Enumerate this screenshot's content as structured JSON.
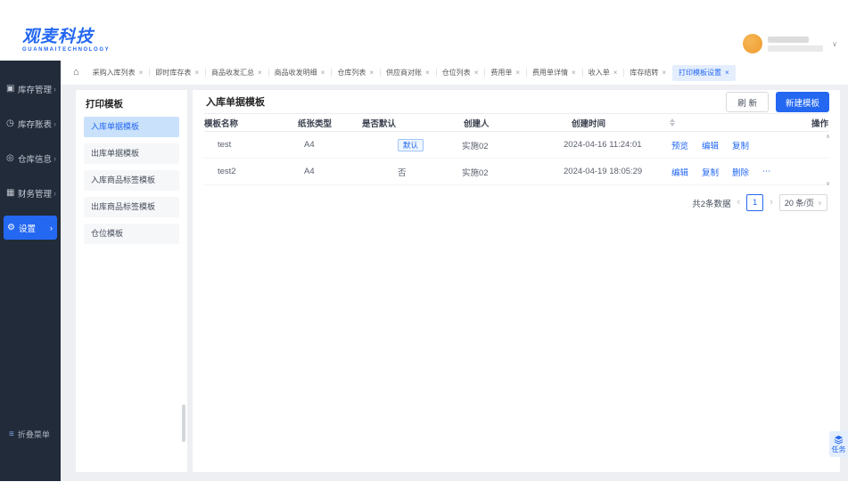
{
  "colors": {
    "primary": "#2468f2",
    "sidebar_bg": "#222b3a",
    "content_bg": "#edeff2",
    "avatar": "#f0a53e"
  },
  "header": {
    "logo_title": "观麦科技",
    "logo_subtitle": "GUANMAITECHNOLOGY",
    "user_menu_chevron": "∨"
  },
  "sidebar": {
    "chevron": "›",
    "collapse": {
      "label": "折叠菜单",
      "glyph": "≡"
    },
    "items": [
      {
        "label": "库存管理",
        "icon": "inventory-icon",
        "glyph": "▣"
      },
      {
        "label": "库存账表",
        "icon": "ledger-icon",
        "glyph": "◷"
      },
      {
        "label": "仓库信息",
        "icon": "warehouse-icon",
        "glyph": "◎"
      },
      {
        "label": "财务管理",
        "icon": "finance-icon",
        "glyph": "▦"
      },
      {
        "label": "设置",
        "icon": "gear-icon",
        "glyph": "⚙",
        "active": true
      }
    ]
  },
  "tabbar": {
    "home_glyph": "⌂",
    "close_glyph": "×",
    "tabs": [
      {
        "label": "采购入库列表"
      },
      {
        "label": "即时库存表"
      },
      {
        "label": "商品收发汇总"
      },
      {
        "label": "商品收发明细"
      },
      {
        "label": "仓库列表"
      },
      {
        "label": "供应商对账"
      },
      {
        "label": "仓位列表"
      },
      {
        "label": "费用单"
      },
      {
        "label": "费用单详情"
      },
      {
        "label": "收入单"
      },
      {
        "label": "库存结转"
      },
      {
        "label": "打印模板设置",
        "active": true
      }
    ]
  },
  "template_panel": {
    "title": "打印模板",
    "items": [
      {
        "label": "入库单据模板",
        "active": true
      },
      {
        "label": "出库单据模板"
      },
      {
        "label": "入库商品标签模板"
      },
      {
        "label": "出库商品标签模板"
      },
      {
        "label": "仓位模板"
      }
    ]
  },
  "main": {
    "title": "入库单据模板",
    "refresh_label": "刷 新",
    "create_label": "新建模板",
    "table": {
      "headers": [
        {
          "label": "模板名称"
        },
        {
          "label": "纸张类型"
        },
        {
          "label": "是否默认"
        },
        {
          "label": "创建人"
        },
        {
          "label": "创建时间",
          "sortable": true
        },
        {
          "label": "操作"
        }
      ],
      "rows": [
        {
          "name": "test",
          "paper": "A4",
          "is_default": "默认",
          "badge": true,
          "creator": "实施02",
          "created_at": "2024-04-16 11:24:01",
          "actions": [
            "预览",
            "编辑",
            "复制"
          ]
        },
        {
          "name": "test2",
          "paper": "A4",
          "is_default": "否",
          "plain": true,
          "creator": "实施02",
          "created_at": "2024-04-19 18:05:29",
          "actions": [
            "编辑",
            "复制",
            "删除",
            "⋯"
          ]
        }
      ]
    },
    "scrollbar": {
      "up": "∧",
      "down": "∨"
    },
    "pagination": {
      "total": "共2条数据",
      "prev": "‹",
      "page": "1",
      "next": "›",
      "page_size": "20 条/页",
      "chevron": "∨"
    }
  },
  "floating_task": {
    "label": "任务"
  }
}
